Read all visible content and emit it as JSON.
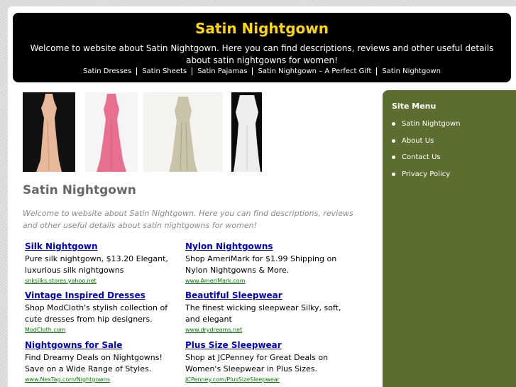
{
  "header": {
    "title": "Satin Nightgown",
    "tagline": "Welcome to website about Satin Nightgown. Here you can find descriptions, reviews and other useful details about satin nightgowns for women!",
    "nav": [
      "Satin Dresses",
      "Satin Sheets",
      "Satin Pajamas",
      "Satin Nightgown – A Perfect Gift",
      "Satin Nightgown"
    ]
  },
  "products": [
    {
      "name": "peach-satin-gown",
      "bg": "#111111",
      "color": "#e8b89a"
    },
    {
      "name": "pink-satin-gown",
      "bg": "#f5f5f5",
      "color": "#e8708e"
    },
    {
      "name": "ivory-satin-gown",
      "bg": "#f4f3ef",
      "color": "#c9c4a9"
    },
    {
      "name": "white-satin-gown",
      "bg": "#0a0a0a",
      "color": "#eeeeee"
    }
  ],
  "main": {
    "title": "Satin Nightgown",
    "intro": "Welcome to website about Satin Nightgown. Here you can find descriptions, reviews and other useful details about satin nightgowns for women!"
  },
  "ads": [
    {
      "title": "Silk Nightgown",
      "desc": "Pure silk nightgown, $13.20 Elegant, luxurious silk nightgowns",
      "url": "snksilks.stores.yahoo.net"
    },
    {
      "title": "Nylon Nightgowns",
      "desc": "Shop AmeriMark for $1.99 Shipping on Nylon Nightgowns & More.",
      "url": "www.AmeriMark.com"
    },
    {
      "title": "Vintage Inspired Dresses",
      "desc": "Shop ModCloth's stylish collection of cute dresses from hip designers.",
      "url": "ModCloth.com"
    },
    {
      "title": "Beautiful Sleepwear",
      "desc": "The finest wicking sleepwear Silky, soft, and elegant",
      "url": "www.drydreams.net"
    },
    {
      "title": "Nightgowns for Sale",
      "desc": "Find Dreamy Deals on Nightgowns! Save on a Wide Range of Styles.",
      "url": "www.NexTag.com/Nightgowns"
    },
    {
      "title": "Plus Size Sleepwear",
      "desc": "Shop at JCPenney for Great Deals on Women's Sleepwear in Plus Sizes.",
      "url": "JCPenney.com/PlusSizeSleepwear"
    }
  ],
  "sidebar": {
    "heading": "Site Menu",
    "items": [
      "Satin Nightgown",
      "About Us",
      "Contact Us",
      "Privacy Policy"
    ]
  },
  "colors": {
    "title_yellow": "#ffd700",
    "sidebar_green": "#5b6e30",
    "ad_link_blue": "#0000cc",
    "ad_url_green": "#008000"
  }
}
